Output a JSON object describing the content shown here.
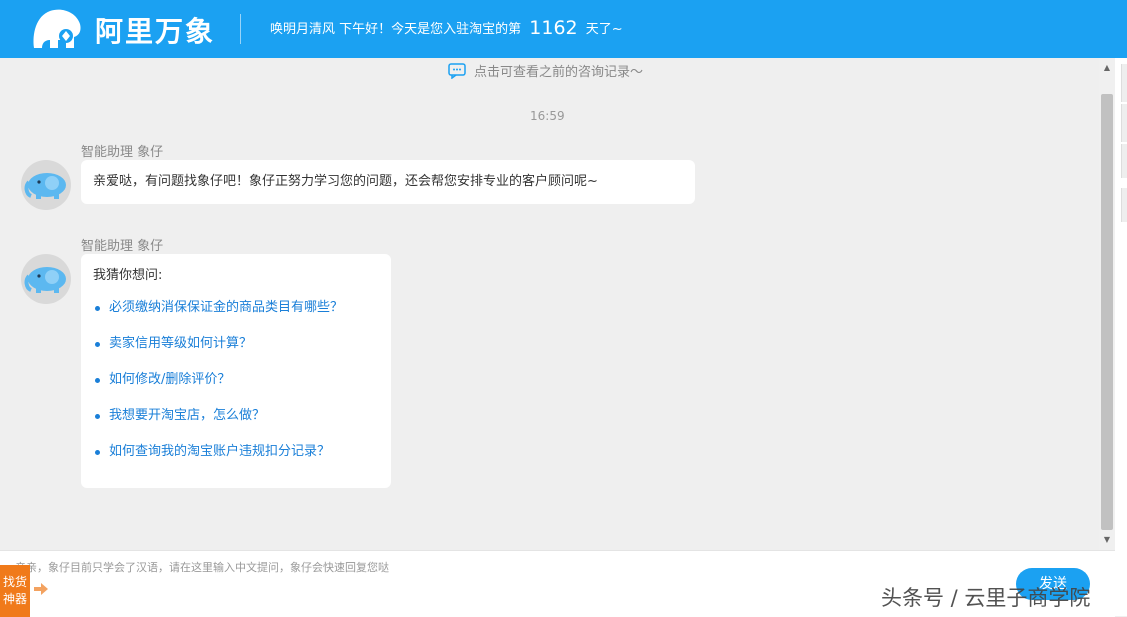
{
  "header": {
    "brand": "阿里万象",
    "greeting_prefix": "唤明月清风 下午好！今天是您入驻淘宝的第",
    "days": "1162",
    "greeting_suffix": "天了~",
    "bg_color": "#1ba1f2"
  },
  "chat": {
    "history_link": "点击可查看之前的咨询记录～",
    "timestamp": "16:59",
    "messages": [
      {
        "sender": "智能助理 象仔",
        "text": "亲爱哒，有问题找象仔吧！象仔正努力学习您的问题，还会帮您安排专业的客户顾问呢~"
      },
      {
        "sender": "智能助理 象仔",
        "title": "我猜你想问:",
        "questions": [
          "必须缴纳消保保证金的商品类目有哪些？",
          "卖家信用等级如何计算？",
          "如何修改/删除评价？",
          "我想要开淘宝店，怎么做？",
          "如何查询我的淘宝账户违规扣分记录？"
        ]
      }
    ]
  },
  "input": {
    "placeholder": "亲亲，象仔目前只学会了汉语，请在这里输入中文提问，象仔会快速回复您哒",
    "send_label": "发送",
    "finder_label_1": "找货",
    "finder_label_2": "神器"
  },
  "watermark": "头条号 / 云里子商学院",
  "icons": {
    "logo": "elephant-logo-icon",
    "history": "chat-bubble-icon",
    "avatar": "elephant-avatar-icon",
    "arrow": "arrow-right-icon"
  }
}
